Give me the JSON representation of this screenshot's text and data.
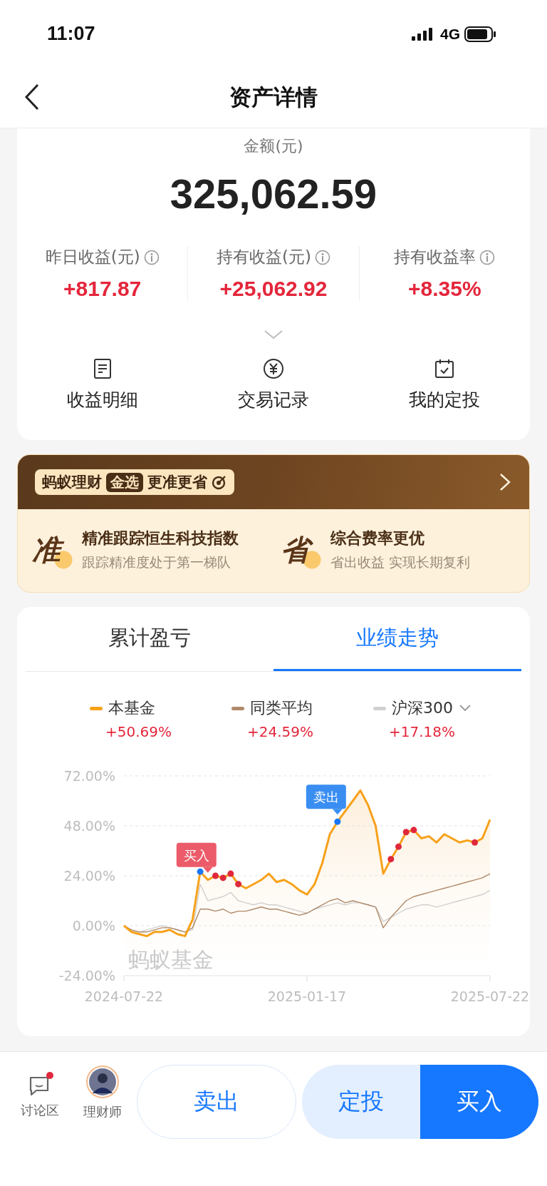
{
  "status_bar": {
    "time": "11:07",
    "network": "4G"
  },
  "nav": {
    "title": "资产详情"
  },
  "summary": {
    "amount_label": "金额(元)",
    "amount": "325,062.59",
    "stats": [
      {
        "label": "昨日收益(元)",
        "value": "+817.87"
      },
      {
        "label": "持有收益(元)",
        "value": "+25,062.92"
      },
      {
        "label": "持有收益率",
        "value": "+8.35%"
      }
    ]
  },
  "actions": [
    {
      "label": "收益明细",
      "kind": "document"
    },
    {
      "label": "交易记录",
      "kind": "yen"
    },
    {
      "label": "我的定投",
      "kind": "calendar"
    }
  ],
  "banner": {
    "brand": "蚂蚁理财",
    "tag": "金选",
    "slogan": "更准更省",
    "features": [
      {
        "mark": "准",
        "title": "精准跟踪恒生科技指数",
        "subtitle": "跟踪精准度处于第一梯队"
      },
      {
        "mark": "省",
        "title": "综合费率更优",
        "subtitle": "省出收益 实现长期复利"
      }
    ]
  },
  "chart_card": {
    "tabs": [
      {
        "label": "累计盈亏",
        "selected": false
      },
      {
        "label": "业绩走势",
        "selected": true
      }
    ],
    "legend": [
      {
        "value": "+50.69%",
        "dropdown": false
      },
      {
        "value": "+24.59%",
        "dropdown": false
      },
      {
        "value": "+17.18%",
        "dropdown": true
      }
    ],
    "watermark": "蚂蚁基金",
    "markers": [
      {
        "kind": "label",
        "text": "买入",
        "color": "#ec5b69"
      },
      {
        "kind": "label",
        "text": "卖出",
        "color": "#3a8ef2"
      },
      {
        "kind": "dot",
        "color": "#1677ff"
      },
      {
        "kind": "dot",
        "color": "#1677ff"
      },
      {
        "kind": "dot",
        "color": "#e0283c"
      },
      {
        "kind": "dot",
        "color": "#e0283c"
      },
      {
        "kind": "dot",
        "color": "#e0283c"
      },
      {
        "kind": "dot",
        "color": "#e0283c"
      },
      {
        "kind": "dot",
        "color": "#e0283c"
      },
      {
        "kind": "dot",
        "color": "#e0283c"
      },
      {
        "kind": "dot",
        "color": "#e0283c"
      },
      {
        "kind": "dot",
        "color": "#e0283c"
      },
      {
        "kind": "dot",
        "color": "#e0283c"
      }
    ],
    "chart_data": {
      "type": "line",
      "grid": true,
      "categories": [
        "2024-07-22",
        null,
        null,
        null,
        null,
        null,
        null,
        null,
        null,
        null,
        null,
        null,
        null,
        null,
        null,
        null,
        null,
        null,
        null,
        null,
        null,
        null,
        null,
        null,
        "2025-01-17",
        null,
        null,
        null,
        null,
        null,
        null,
        null,
        null,
        null,
        null,
        null,
        null,
        null,
        null,
        null,
        null,
        null,
        null,
        null,
        null,
        null,
        null,
        null,
        "2025-07-22"
      ],
      "series": [
        {
          "name": "本基金",
          "color": "#f7a11a",
          "values": [
            0,
            -3,
            -4,
            -5,
            -3,
            -3,
            -2,
            -4,
            -5,
            3,
            26,
            22,
            24,
            23,
            25,
            20,
            18,
            20,
            22,
            25,
            21,
            22,
            20,
            17,
            15,
            20,
            30,
            44,
            50,
            55,
            60,
            65,
            58,
            48,
            25,
            32,
            38,
            45,
            46,
            42,
            43,
            40,
            44,
            42,
            40,
            41,
            40,
            42,
            51
          ]
        },
        {
          "name": "同类平均",
          "color": "#b08a6a",
          "values": [
            0,
            -2,
            -3,
            -3,
            -2,
            -1,
            -1,
            -2,
            -3,
            -1,
            8,
            8,
            7,
            8,
            6,
            7,
            7,
            8,
            9,
            8,
            8,
            7,
            6,
            5,
            6,
            8,
            10,
            12,
            13,
            11,
            12,
            11,
            10,
            9,
            -1,
            4,
            8,
            12,
            14,
            15,
            16,
            17,
            18,
            19,
            20,
            21,
            22,
            23,
            25
          ]
        },
        {
          "name": "沪深300",
          "color": "#d0d0d0",
          "values": [
            0,
            -2,
            -3,
            -2,
            -1,
            0,
            -1,
            -2,
            -3,
            -2,
            20,
            12,
            13,
            14,
            16,
            12,
            11,
            10,
            11,
            10,
            10,
            9,
            8,
            7,
            6,
            8,
            9,
            10,
            11,
            10,
            11,
            11,
            10,
            9,
            2,
            4,
            6,
            8,
            9,
            10,
            10,
            9,
            10,
            11,
            12,
            13,
            14,
            15,
            17
          ]
        }
      ],
      "ylim": [
        -24,
        72
      ],
      "yticks": [
        {
          "value": 72,
          "label": "72.00%"
        },
        {
          "value": 48,
          "label": "48.00%"
        },
        {
          "value": 24,
          "label": "24.00%"
        },
        {
          "value": 0,
          "label": "0.00%"
        },
        {
          "value": -24,
          "label": "-24.00%"
        }
      ]
    }
  },
  "bottom_bar": {
    "items": [
      {
        "label": "讨论区",
        "kind": "chat",
        "badge": true
      },
      {
        "label": "理财师",
        "kind": "avatar",
        "badge": false
      }
    ],
    "buttons": [
      {
        "label": "卖出",
        "kind": "outline"
      },
      {
        "label": "定投",
        "kind": "light"
      },
      {
        "label": "买入",
        "kind": "primary"
      }
    ]
  }
}
